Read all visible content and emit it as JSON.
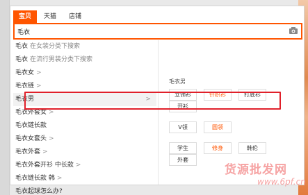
{
  "tabs": [
    "宝贝",
    "天猫",
    "店铺"
  ],
  "search": {
    "value": "毛衣"
  },
  "suggestions": [
    {
      "text": "毛衣",
      "sub": "在女装分类下搜索",
      "arrow": ""
    },
    {
      "text": "毛衣",
      "sub": "在流行男装分类下搜索",
      "arrow": ""
    },
    {
      "text": "毛衣女",
      "sub": "",
      "arrow": ">"
    },
    {
      "text": "毛衣链",
      "sub": "",
      "arrow": ">"
    },
    {
      "text": "毛衣男",
      "sub": "",
      "arrow": ">"
    },
    {
      "text": "毛衣外套女",
      "sub": "",
      "arrow": ">"
    },
    {
      "text": "毛衣链长款",
      "sub": "",
      "arrow": ""
    },
    {
      "text": "毛衣女套头",
      "sub": "",
      "arrow": ">"
    },
    {
      "text": "毛衣外套",
      "sub": "",
      "arrow": ">"
    },
    {
      "text": "毛衣外套开衫 中长款",
      "sub": "",
      "arrow": ">"
    },
    {
      "text": "毛衣链长款 韩",
      "sub": "",
      "arrow": ">"
    },
    {
      "text": "毛衣起球怎么办?",
      "sub": "",
      "arrow": ""
    }
  ],
  "panel": {
    "title": "毛衣男",
    "group1": [
      "立领衫",
      "针织衫",
      "打底衫",
      "开衫"
    ],
    "group2": [
      "V领",
      "圆领"
    ],
    "group3": [
      "学生",
      "修身",
      "韩伦",
      "外套"
    ]
  },
  "watermark": {
    "text": "货源批发网",
    "url": "www.6pf.cn"
  },
  "colors": {
    "accent": "#ff5500",
    "highlight": "#e0202a"
  }
}
